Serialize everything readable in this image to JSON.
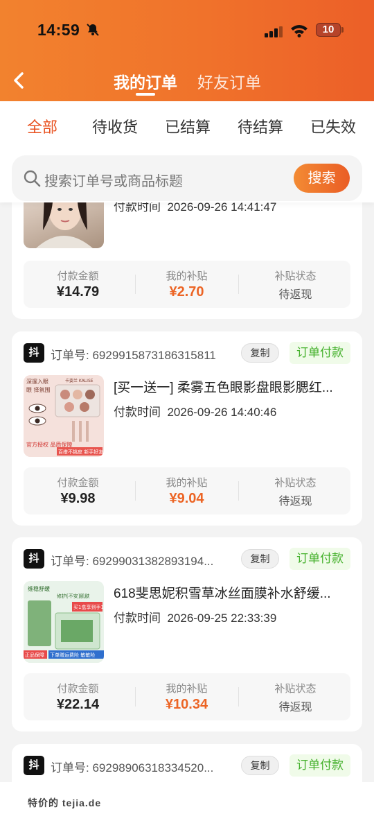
{
  "status_bar": {
    "time": "14:59",
    "battery": "10"
  },
  "header": {
    "tabs": [
      "我的订单",
      "好友订单"
    ],
    "active_tab": 0
  },
  "filters": {
    "tabs": [
      "全部",
      "待收货",
      "已结算",
      "待结算",
      "已失效"
    ],
    "active": 0
  },
  "search": {
    "placeholder": "搜索订单号或商品标题",
    "button": "搜索"
  },
  "labels": {
    "order_prefix": "订单号:",
    "copy": "复制",
    "paid_time": "付款时间",
    "amount": "付款金额",
    "subsidy": "我的补贴",
    "subsidy_status": "补贴状态"
  },
  "orders": [
    {
      "order_no": "",
      "status": "",
      "title": "",
      "paid_time": "2026-09-26 14:41:47",
      "amount": "¥14.79",
      "subsidy": "¥2.70",
      "subsidy_status": "待返现"
    },
    {
      "platform_badge": "抖",
      "order_no": "6929915873186315811",
      "status": "订单付款",
      "title": "[买一送一] 柔雾五色眼影盘眼影腮红...",
      "paid_time": "2026-09-26 14:40:46",
      "amount": "¥9.98",
      "subsidy": "¥9.04",
      "subsidy_status": "待返现",
      "thumb_text": {
        "top": "深邃入眼",
        "mid": "眼 择氛围",
        "left": "官方授权 品质保障",
        "right": "百搭不挑皮 新手好友盘",
        "brand": "卡姿兰 KALISE"
      }
    },
    {
      "platform_badge": "抖",
      "order_no": "69299031382893194...",
      "status": "订单付款",
      "title": "618斐思妮积雪草冰丝面膜补水舒缓...",
      "paid_time": "2026-09-25 22:33:39",
      "amount": "¥22.14",
      "subsidy": "¥10.34",
      "subsidy_status": "待返现",
      "thumb_text": {
        "top": "维稳舒缓",
        "tag": "修护[不安]肌肤",
        "promo": "买1盒享到手11片",
        "left": "正品保障",
        "bottom": "下单赠运费险 敏敏险"
      }
    },
    {
      "platform_badge": "抖",
      "order_no": "69298906318334520...",
      "status": "订单付款"
    }
  ],
  "watermark": "特价的 tejia.de",
  "colors": {
    "accent": "#ec5f28",
    "subsidy": "#ec6424",
    "status_green": "#43b02a"
  }
}
